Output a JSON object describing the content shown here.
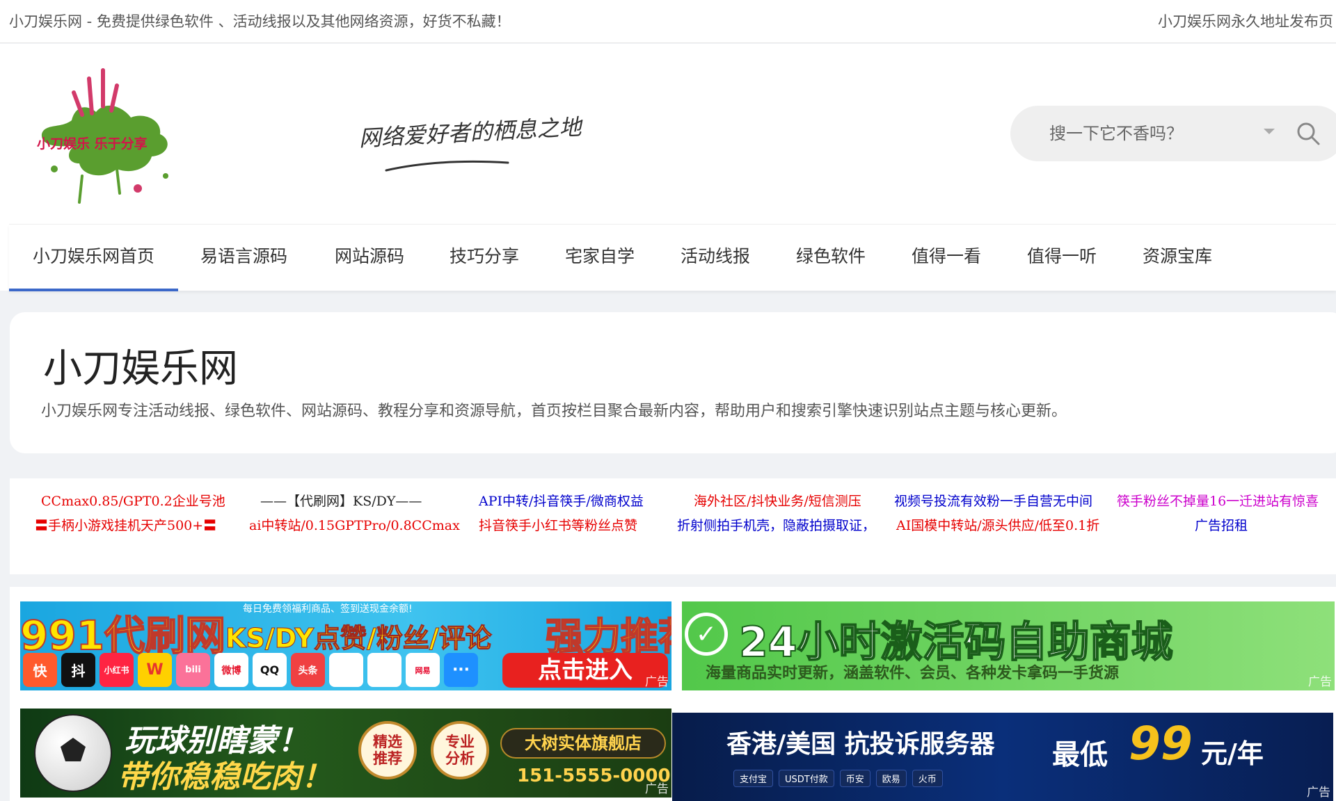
{
  "topbar": {
    "left_text": "小刀娱乐网 - 免费提供绿色软件 、活动线报以及其他网络资源，好货不私藏！",
    "right_text": "小刀娱乐网永久地址发布页"
  },
  "header": {
    "logo_text": "小刀娱乐 乐于分享",
    "slogan": "网络爱好者的栖息之地",
    "search_placeholder": "搜一下它不香吗？"
  },
  "nav": {
    "active_color": "#3b68c9",
    "items": [
      "小刀娱乐网首页",
      "易语言源码",
      "网站源码",
      "技巧分享",
      "宅家自学",
      "活动线报",
      "绿色软件",
      "值得一看",
      "值得一听",
      "资源宝库"
    ]
  },
  "intro": {
    "title": "小刀娱乐网",
    "description": "小刀娱乐网专注活动线报、绿色软件、网站源码、教程分享和资源导航，首页按栏目聚合最新内容，帮助用户和搜索引擎快速识别站点主题与核心更新。"
  },
  "text_links": [
    {
      "label": "CCmax0.85/GPT0.2企业号池",
      "color": "#e60000"
    },
    {
      "label": "——【代刷网】KS/DY——",
      "color": "#222222"
    },
    {
      "label": "API中转/抖音筷手/微商权益",
      "color": "#0000cc"
    },
    {
      "label": "海外社区/抖快业务/短信测压",
      "color": "#e60000"
    },
    {
      "label": "视频号投流有效粉一手自营无中间",
      "color": "#0000cc"
    },
    {
      "label": "筷手粉丝不掉量16一迁进站有惊喜",
      "color": "#cc00cc"
    },
    {
      "label": "〓手柄小游戏挂机天产500+〓",
      "color": "#e60000"
    },
    {
      "label": "ai中转站/0.15GPTPro/0.8CCmax",
      "color": "#e60000"
    },
    {
      "label": "抖音筷手小红书等粉丝点赞",
      "color": "#e60000"
    },
    {
      "label": "折射侧拍手机壳，隐蔽拍摄取证，",
      "color": "#0000cc"
    },
    {
      "label": "AI国模中转站/源头供应/低至0.1折",
      "color": "#e60000"
    },
    {
      "label": "广告招租",
      "color": "#0000cc"
    }
  ],
  "banners": {
    "ad_tag": "广告",
    "b1": {
      "title": "991代刷网",
      "sub": "KS/DY点赞/粉丝/评论",
      "recommend": "强力推荐",
      "tagline": "每日免费领福利商品、签到送现金余额!",
      "cta": "点击进入",
      "apps": [
        "快",
        "抖",
        "小红书",
        "W",
        "bili",
        "微博",
        "QQ",
        "头条",
        "",
        "",
        "网易",
        "···"
      ]
    },
    "b2": {
      "title": "24小时激活码自助商城",
      "sub": "海量商品实时更新，涵盖软件、会员、各种发卡拿码一手货源"
    },
    "b3": {
      "line1": "玩球别瞎蒙！",
      "line2": "带你稳稳吃肉！",
      "seal1": "精选推荐",
      "seal2": "专业分析",
      "store": "大树实体旗舰店",
      "phone": "151-5555-0000"
    },
    "b4": {
      "title": "香港/美国 抗投诉服务器",
      "price_prefix": "最低",
      "price": "99",
      "price_unit": "元/年",
      "pays": [
        "支付宝",
        "USDT付款",
        "币安",
        "欧易",
        "火币"
      ]
    }
  }
}
